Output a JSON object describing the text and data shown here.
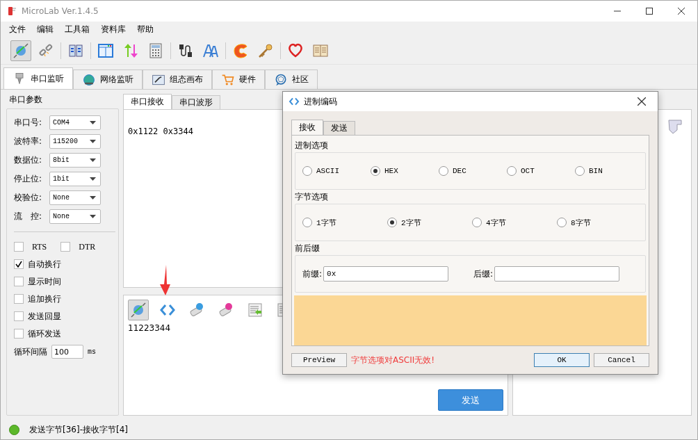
{
  "window": {
    "title": "MicroLab Ver.1.4.5"
  },
  "menu": [
    "文件",
    "编辑",
    "工具箱",
    "资料库",
    "帮助"
  ],
  "toolbar": [
    {
      "kind": "connect",
      "selected": true
    },
    {
      "kind": "chain",
      "selected": false
    },
    {
      "kind": "columns",
      "selected": false
    },
    {
      "kind": "window",
      "selected": false
    },
    {
      "kind": "updown",
      "selected": false
    },
    {
      "kind": "calculator",
      "selected": false
    },
    {
      "kind": "cable",
      "selected": false
    },
    {
      "kind": "font",
      "selected": false
    },
    {
      "kind": "flame",
      "selected": false
    },
    {
      "kind": "key",
      "selected": false
    },
    {
      "kind": "heart",
      "selected": false
    },
    {
      "kind": "book",
      "selected": false
    }
  ],
  "main_tabs": [
    {
      "label": "串口监听",
      "kind": "port",
      "selected": true
    },
    {
      "label": "网络监听",
      "kind": "globe",
      "selected": false
    },
    {
      "label": "组态画布",
      "kind": "canvas",
      "selected": false
    },
    {
      "label": "硬件",
      "kind": "cart",
      "selected": false
    },
    {
      "label": "社区",
      "kind": "community",
      "selected": false
    }
  ],
  "serial_params": {
    "title": "串口参数",
    "fields": [
      {
        "label": "串口号:",
        "value": "COM4"
      },
      {
        "label": "波特率:",
        "value": "115200"
      },
      {
        "label": "数据位:",
        "value": "8bit"
      },
      {
        "label": "停止位:",
        "value": "1bit"
      },
      {
        "label": "校验位:",
        "value": "None"
      },
      {
        "label": "流　控:",
        "value": "None"
      }
    ],
    "line_signals": [
      {
        "label": "RTS",
        "checked": false
      },
      {
        "label": "DTR",
        "checked": false
      }
    ],
    "options": [
      {
        "label": "自动换行",
        "checked": true
      },
      {
        "label": "显示时间",
        "checked": false
      },
      {
        "label": "追加换行",
        "checked": false
      },
      {
        "label": "发送回显",
        "checked": false
      },
      {
        "label": "循环发送",
        "checked": false
      }
    ],
    "interval": {
      "label": "循环间隔",
      "value": "100",
      "unit": "ms"
    }
  },
  "receive_tabs": [
    {
      "label": "串口接收",
      "selected": true
    },
    {
      "label": "串口波形",
      "selected": false
    }
  ],
  "receive_text": "0x1122 0x3344",
  "send_toolbar": [
    {
      "kind": "connect",
      "selected": true
    },
    {
      "kind": "code",
      "selected": false
    },
    {
      "kind": "eraser-t",
      "selected": false
    },
    {
      "kind": "eraser-r",
      "selected": false
    },
    {
      "kind": "import",
      "selected": false
    },
    {
      "kind": "export",
      "selected": false
    }
  ],
  "send_text": "11223344",
  "send_button": "发送",
  "status": {
    "connected": true,
    "text": "发送字节[36]-接收字节[4]"
  },
  "dialog": {
    "title": "进制编码",
    "tabs": [
      {
        "label": "接收",
        "selected": true
      },
      {
        "label": "发送",
        "selected": false
      }
    ],
    "base": {
      "title": "进制选项",
      "options": [
        {
          "label": "ASCII",
          "selected": false
        },
        {
          "label": "HEX",
          "selected": true
        },
        {
          "label": "DEC",
          "selected": false
        },
        {
          "label": "OCT",
          "selected": false
        },
        {
          "label": "BIN",
          "selected": false
        }
      ]
    },
    "bytes": {
      "title": "字节选项",
      "options": [
        {
          "label": "1字节",
          "selected": false
        },
        {
          "label": "2字节",
          "selected": true
        },
        {
          "label": "4字节",
          "selected": false
        },
        {
          "label": "8字节",
          "selected": false
        }
      ]
    },
    "affix": {
      "title": "前后缀",
      "prefix_label": "前缀:",
      "prefix_value": "0x",
      "suffix_label": "后缀:"
    },
    "preview_button": "PreView",
    "warning": "字节选项对ASCII无效!",
    "ok": "OK",
    "cancel": "Cancel"
  }
}
